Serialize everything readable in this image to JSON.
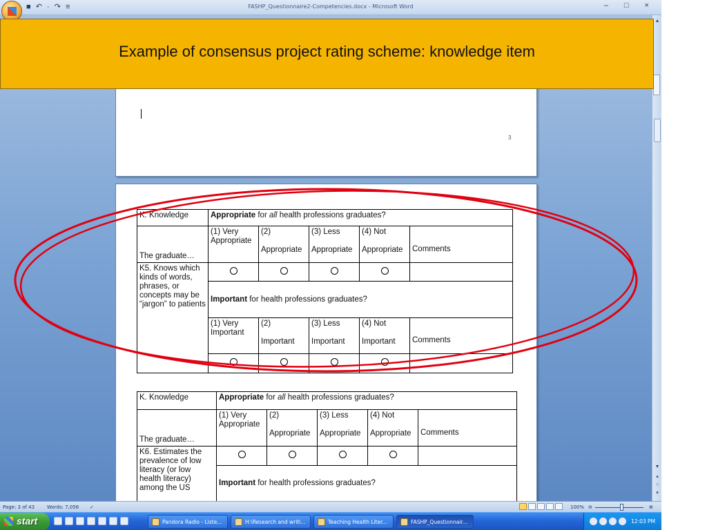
{
  "window": {
    "title": "FASHP_Questionnaire2-Competencies.docx - Microsoft Word",
    "quick_access": "■ ↶ · ↷ ≡",
    "controls": "– □ ×"
  },
  "banner": {
    "text": "Example of consensus project rating scheme: knowledge item"
  },
  "page1": {
    "cursor_text": "I",
    "page_number": "3"
  },
  "table1": {
    "domain": "K. Knowledge",
    "stem": "The graduate…",
    "item": "K5. Knows which kinds of words, phrases, or concepts may be “jargon” to patients",
    "appropriate_question_bold": "Appropriate",
    "appropriate_question_pre": " for ",
    "appropriate_question_italic": "all",
    "appropriate_question_post": " health professions graduates?",
    "appropriate_scale": [
      "(1) Very Appropriate",
      "(2)",
      "(3) Less",
      "(4) Not"
    ],
    "appropriate_scale_sub": [
      "",
      "Appropriate",
      "Appropriate",
      "Appropriate"
    ],
    "comments": "Comments",
    "important_question_bold": "Important",
    "important_question_rest": " for health professions graduates?",
    "important_scale": [
      "(1) Very Important",
      "(2)",
      "(3) Less",
      "(4) Not"
    ],
    "important_scale_sub": [
      "",
      "Important",
      "Important",
      "Important"
    ]
  },
  "table2": {
    "domain": "K. Knowledge",
    "stem": "The graduate…",
    "item": "K6. Estimates the prevalence of low literacy (or low health literacy) among the US",
    "appropriate_question_bold": "Appropriate",
    "appropriate_question_pre": " for ",
    "appropriate_question_italic": "all",
    "appropriate_question_post": " health professions graduates?",
    "appropriate_scale": [
      "(1) Very Appropriate",
      "(2)",
      "(3) Less",
      "(4) Not"
    ],
    "appropriate_scale_sub": [
      "",
      "Appropriate",
      "Appropriate",
      "Appropriate"
    ],
    "comments": "Comments",
    "important_question_bold": "Important",
    "important_question_rest": " for health professions graduates?"
  },
  "statusbar": {
    "page": "Page: 3 of 43",
    "words": "Words: 7,056",
    "zoom": "100%"
  },
  "taskbar": {
    "start_label": "start",
    "tasks": [
      "Pandora Radio - Liste...",
      "H:\\Research and writi...",
      "Teaching Health Liter...",
      "FASHP_Questionnair..."
    ],
    "clock": "12:03 PM"
  },
  "colors": {
    "banner": "#f5b400",
    "ellipse": "#e00010",
    "taskbar": "#2566d8"
  }
}
